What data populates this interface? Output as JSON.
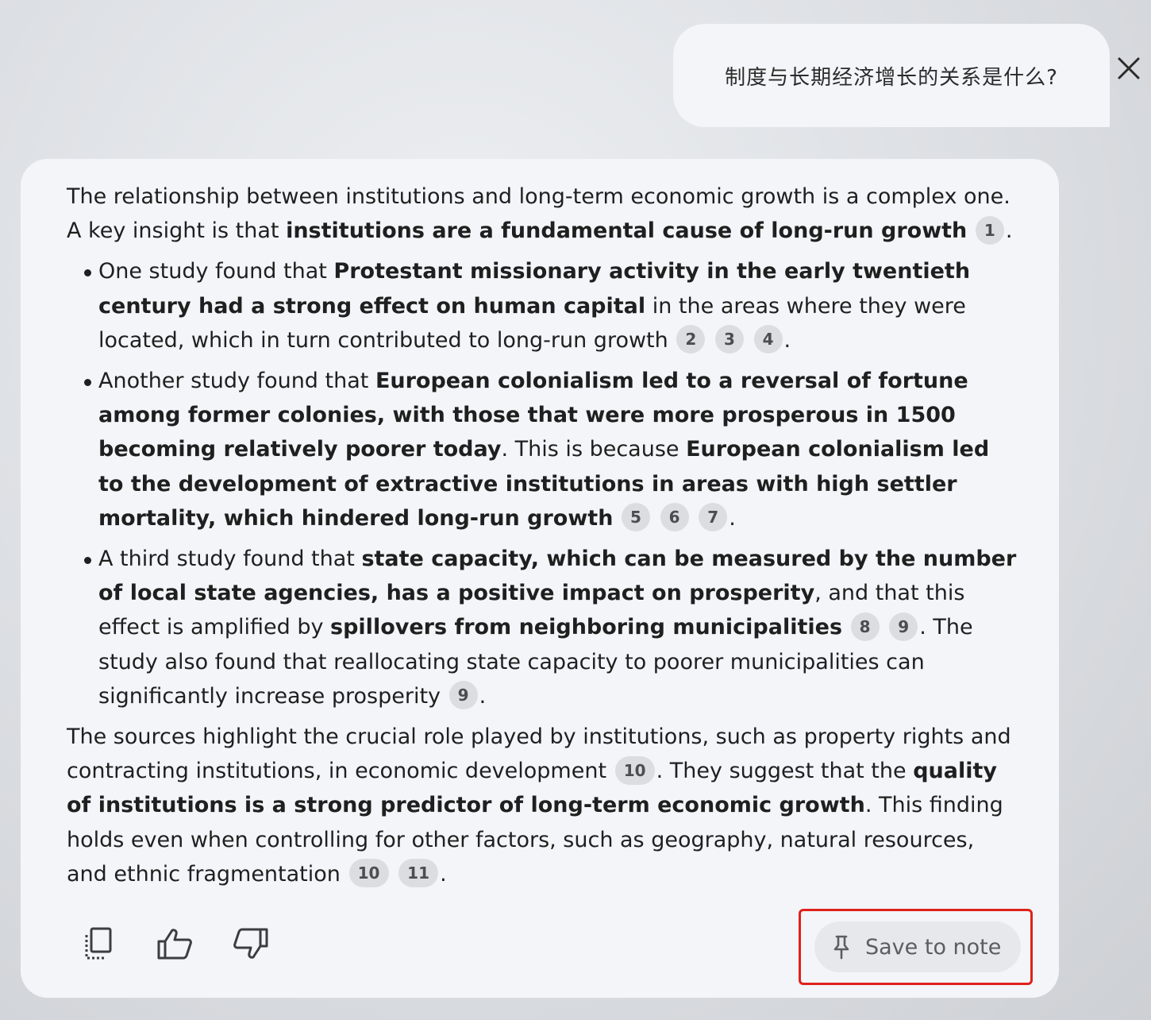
{
  "query": {
    "text": "制度与长期经济增长的关系是什么?"
  },
  "close_icon": "close-icon",
  "answer": {
    "p1_a": "The relationship between institutions and long-term economic growth is a complex one. A key insight is that ",
    "p1_b": "institutions are a fundamental cause of long-run growth",
    "p1_c1": "1",
    "p1_end": ".",
    "b1_a": "One study found that ",
    "b1_b": "Protestant missionary activity in the early twentieth century had a strong effect on human capital",
    "b1_c": " in the areas where they were located, which in turn contributed to long-run growth",
    "b1_c1": "2",
    "b1_c2": "3",
    "b1_c3": "4",
    "b1_end": ".",
    "b2_a": "Another study found that ",
    "b2_b": "European colonialism led to a reversal of fortune among former colonies, with those that were more prosperous in 1500 becoming relatively poorer today",
    "b2_c": ". This is because ",
    "b2_d": "European colonialism led to the development of extractive institutions in areas with high settler mortality, which hindered long-run growth",
    "b2_c1": "5",
    "b2_c2": "6",
    "b2_c3": "7",
    "b2_end": ".",
    "b3_a": "A third study found that ",
    "b3_b": "state capacity, which can be measured by the number of local state agencies, has a positive impact on prosperity",
    "b3_c": ", and that this effect is amplified by ",
    "b3_d": "spillovers from neighboring municipalities",
    "b3_c1": "8",
    "b3_c2": "9",
    "b3_e": ". The study also found that reallocating state capacity to poorer municipalities can significantly increase prosperity",
    "b3_c3": "9",
    "b3_end": ".",
    "p2_a": "The sources highlight the crucial role played by institutions, such as property rights and contracting institutions, in economic development",
    "p2_c1": "10",
    "p2_b": ". They suggest that the ",
    "p2_c": "quality of institutions is a strong predictor of long-term economic growth",
    "p2_d": ". This finding holds even when controlling for other factors, such as geography, natural resources, and ethnic fragmentation",
    "p2_c2": "10",
    "p2_c3": "11",
    "p2_end": "."
  },
  "actions": {
    "copy_icon": "copy-icon",
    "thumbs_up_icon": "thumbs-up-icon",
    "thumbs_down_icon": "thumbs-down-icon",
    "pin_icon": "pin-icon",
    "save_label": "Save to note"
  },
  "colors": {
    "highlight": "#e0211b",
    "card": "#f3f5f8",
    "citation": "#dcdde0"
  }
}
